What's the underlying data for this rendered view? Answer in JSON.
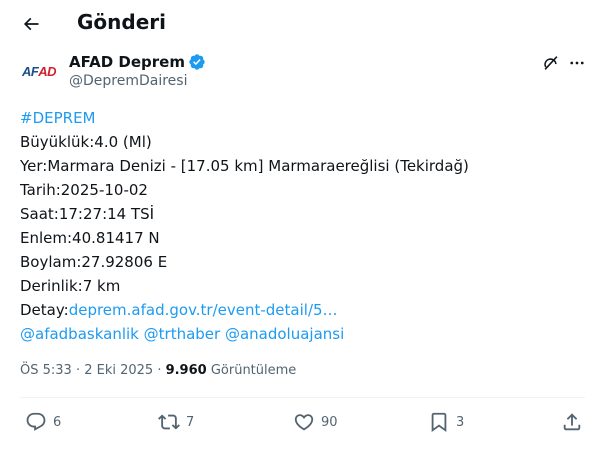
{
  "header": {
    "title": "Gönderi"
  },
  "author": {
    "avatar_text_1": "AF",
    "avatar_text_2": "AD",
    "name": "AFAD Deprem",
    "handle": "@DepremDairesi"
  },
  "tweet": {
    "hashtag": "#DEPREM",
    "magnitude": "Büyüklük:4.0 (Ml)",
    "location": "Yer:Marmara Denizi - [17.05 km] Marmaraereğlisi (Tekirdağ)",
    "date": "Tarih:2025-10-02",
    "time": "Saat:17:27:14 TSİ",
    "latitude": "Enlem:40.81417 N",
    "longitude": "Boylam:27.92806 E",
    "depth": "Derinlik:7 km",
    "detail_label": "Detay:",
    "detail_link": "deprem.afad.gov.tr/event-detail/5…",
    "mentions": [
      "@afadbaskanlik",
      "@trthaber",
      "@anadoluajansi"
    ]
  },
  "meta": {
    "timestamp": "ÖS 5:33 · 2 Eki 2025 · ",
    "views_count": "9.960",
    "views_label": " Görüntüleme"
  },
  "actions": {
    "reply_count": "6",
    "retweet_count": "7",
    "like_count": "90",
    "bookmark_count": "3"
  },
  "colors": {
    "link": "#1d9bf0",
    "text": "#0f1419",
    "secondary": "#536471",
    "verified": "#1d9bf0"
  },
  "icons": [
    "back-arrow-icon",
    "verified-badge-icon",
    "grok-icon",
    "more-icon",
    "reply-icon",
    "retweet-icon",
    "like-icon",
    "bookmark-icon",
    "share-icon"
  ]
}
